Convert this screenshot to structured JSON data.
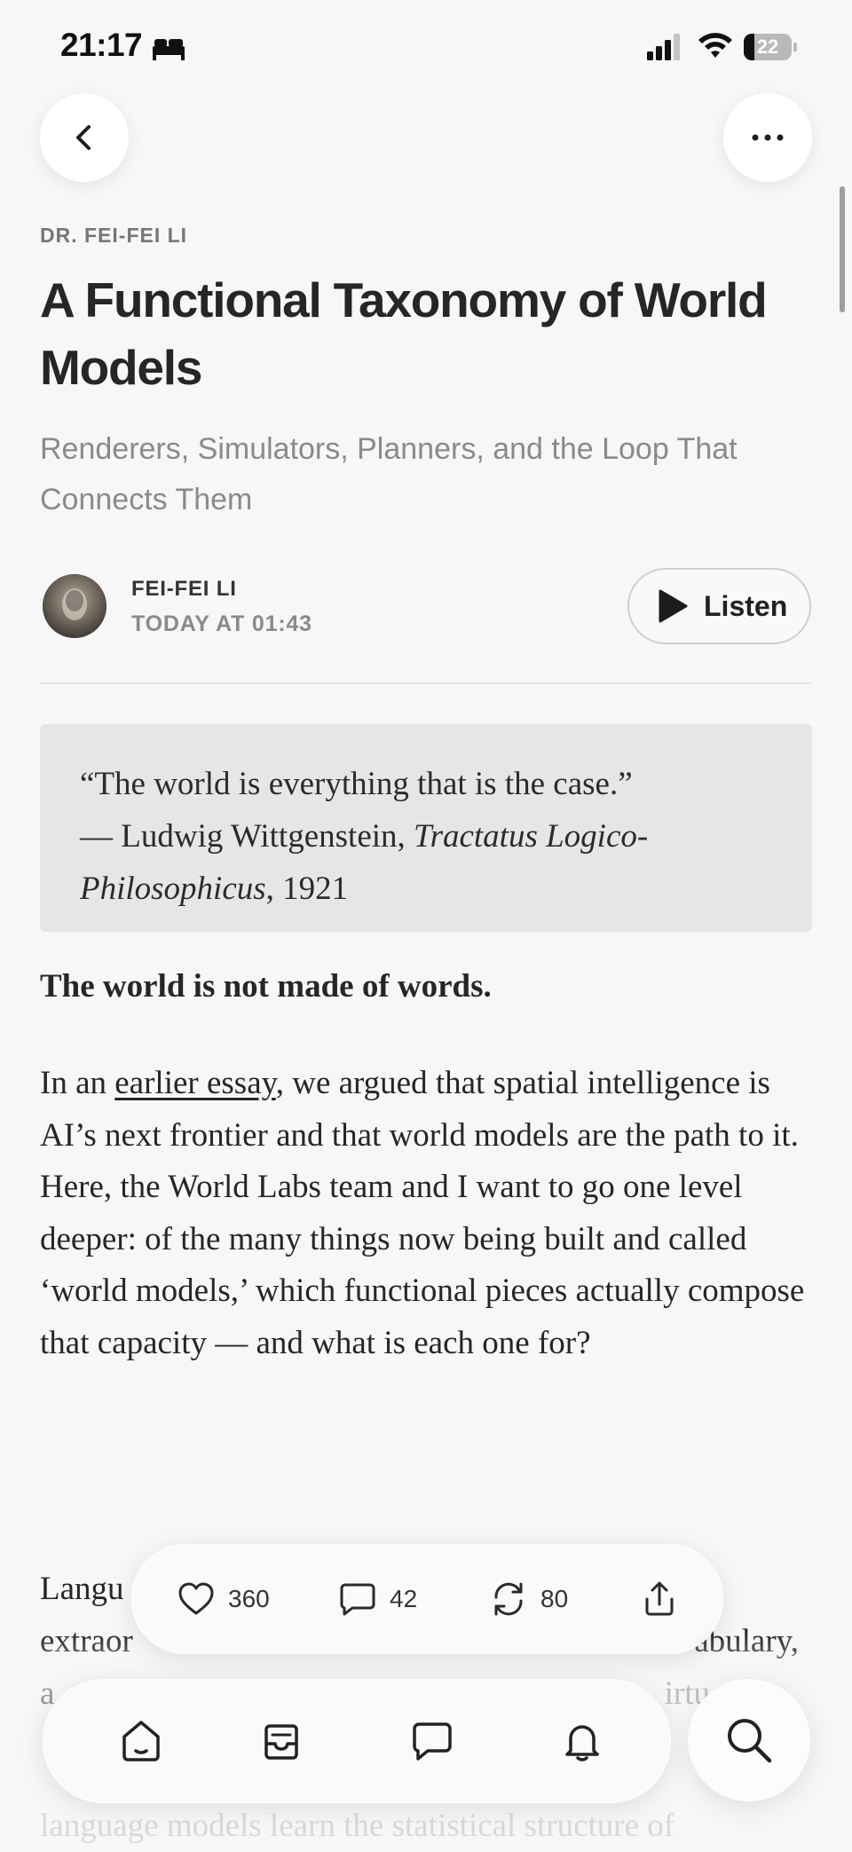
{
  "status_bar": {
    "time": "21:17",
    "battery_level": "22",
    "battery_fraction": 0.22,
    "icons": [
      "bed-icon",
      "signal-icon",
      "wifi-icon",
      "battery-icon"
    ]
  },
  "nav": {
    "back_icon": "chevron-left-icon",
    "more_icon": "ellipsis-icon"
  },
  "post": {
    "kicker": "DR. FEI-FEI LI",
    "title": "A Functional Taxonomy of World Models",
    "subtitle": "Renderers, Simulators, Planners, and the Loop That Connects Them",
    "author": "FEI-FEI LI",
    "date": "TODAY AT 01:43",
    "listen_label": "Listen"
  },
  "quote": {
    "text": "“The world is everything that is the case.”",
    "attribution_prefix": "— Ludwig Wittgenstein,",
    "work_part1": "Tractatus Logico-",
    "work_part2": "Philosophicus",
    "year": ", 1921"
  },
  "body": {
    "heading": "The world is not made of words.",
    "para1_prefix": "In an ",
    "para1_link": "earlier essay",
    "para1_rest": ", we argued that spatial intelligence is AI’s next frontier and that world models are the path to it. Here, the World Labs team and I want to go one level deeper: of the many things now being built and called ‘world models,’ which functional pieces actually compose that capacity — and what is each one for?",
    "para2_visible": "Langu",
    "para2_line2_start": "extraor",
    "para2_line2_end": "abulary,",
    "para2_line3_start": "a",
    "para2_line3_end": "irtu",
    "para2_line5": "language models learn the statistical structure of"
  },
  "engagement": {
    "likes": "360",
    "comments": "42",
    "restacks": "80",
    "icons": [
      "heart-icon",
      "comment-icon",
      "restack-icon",
      "share-icon"
    ]
  },
  "tab_bar": {
    "icons": [
      "home-icon",
      "inbox-icon",
      "chat-icon",
      "bell-icon",
      "search-icon"
    ]
  }
}
